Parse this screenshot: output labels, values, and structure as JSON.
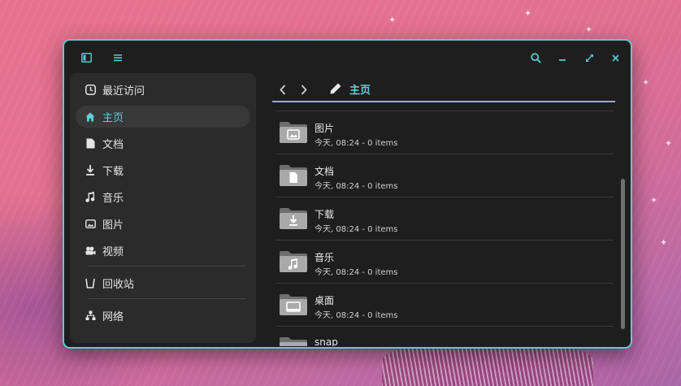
{
  "sidebar": {
    "items": [
      {
        "label": "最近访问",
        "icon": "clock-icon"
      },
      {
        "label": "主页",
        "icon": "home-icon",
        "active": true
      },
      {
        "label": "文档",
        "icon": "document-icon"
      },
      {
        "label": "下载",
        "icon": "download-icon"
      },
      {
        "label": "音乐",
        "icon": "music-icon"
      },
      {
        "label": "图片",
        "icon": "picture-icon"
      },
      {
        "label": "视频",
        "icon": "video-icon"
      },
      {
        "label": "回收站",
        "icon": "trash-icon"
      },
      {
        "label": "网络",
        "icon": "network-icon"
      }
    ]
  },
  "header": {
    "breadcrumb": "主页"
  },
  "files": [
    {
      "name": "图片",
      "meta": "今天, 08:24 - 0 items",
      "icon": "folder-pictures-icon"
    },
    {
      "name": "文档",
      "meta": "今天, 08:24 - 0 items",
      "icon": "folder-documents-icon"
    },
    {
      "name": "下载",
      "meta": "今天, 08:24 - 0 items",
      "icon": "folder-download-icon"
    },
    {
      "name": "音乐",
      "meta": "今天, 08:24 - 0 items",
      "icon": "folder-music-icon"
    },
    {
      "name": "桌面",
      "meta": "今天, 08:24 - 0 items",
      "icon": "folder-desktop-icon"
    },
    {
      "name": "snap",
      "meta": "",
      "icon": "folder-icon"
    }
  ],
  "colors": {
    "accent": "#5fd0d7",
    "window_border": "#63c7cf",
    "window_bg": "#1e1e1e",
    "sidebar_bg": "#2b2b2b"
  }
}
